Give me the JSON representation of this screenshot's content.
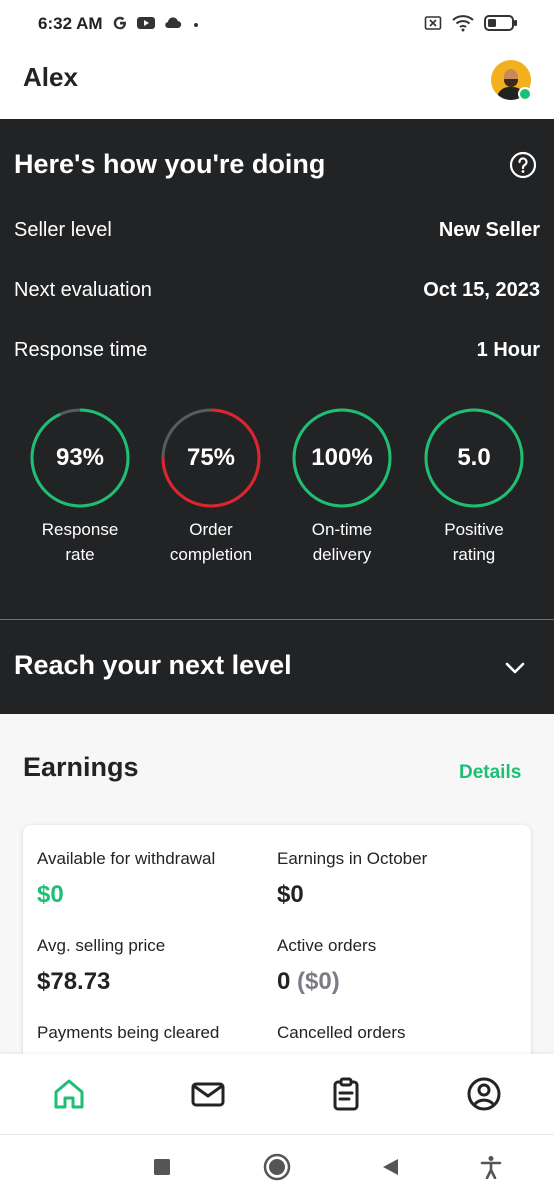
{
  "status_bar": {
    "time": "6:32 AM",
    "left_icons": [
      "google-icon",
      "youtube-icon",
      "cloud-icon",
      "dot-icon"
    ],
    "right_icons": [
      "no-sim-icon",
      "wifi-icon",
      "battery-icon"
    ]
  },
  "header": {
    "user_name": "Alex",
    "avatar": "avatar-icon",
    "online_status_color": "#1dbf73"
  },
  "performance": {
    "title": "Here's how you're doing",
    "stats": [
      {
        "label": "Seller level",
        "value": "New Seller"
      },
      {
        "label": "Next evaluation",
        "value": "Oct 15, 2023"
      },
      {
        "label": "Response time",
        "value": "1 Hour"
      }
    ],
    "metrics": [
      {
        "value": "93%",
        "label_line1": "Response",
        "label_line2": "rate",
        "fraction": 0.93,
        "color": "#1dbf73"
      },
      {
        "value": "75%",
        "label_line1": "Order",
        "label_line2": "completion",
        "fraction": 0.75,
        "color": "#e0232e"
      },
      {
        "value": "100%",
        "label_line1": "On-time",
        "label_line2": "delivery",
        "fraction": 1.0,
        "color": "#1dbf73"
      },
      {
        "value": "5.0",
        "label_line1": "Positive",
        "label_line2": "rating",
        "fraction": 1.0,
        "color": "#1dbf73"
      }
    ],
    "next_level": "Reach your next level"
  },
  "earnings": {
    "title": "Earnings",
    "details_label": "Details",
    "available_label": "Available for withdrawal",
    "available_value": "$0",
    "month_label": "Earnings in October",
    "month_value": "$0",
    "avg_price_label": "Avg. selling price",
    "avg_price_value": "$78.73",
    "active_orders_label": "Active orders",
    "active_orders_count": "0",
    "active_orders_amount": "($0)",
    "cleared_label": "Payments being cleared",
    "cancelled_label": "Cancelled orders"
  },
  "bottom_nav": [
    "home-icon",
    "inbox-icon",
    "orders-icon",
    "profile-icon"
  ],
  "colors": {
    "accent": "#1dbf73",
    "dark_bg": "#222325",
    "alert": "#e0232e"
  }
}
